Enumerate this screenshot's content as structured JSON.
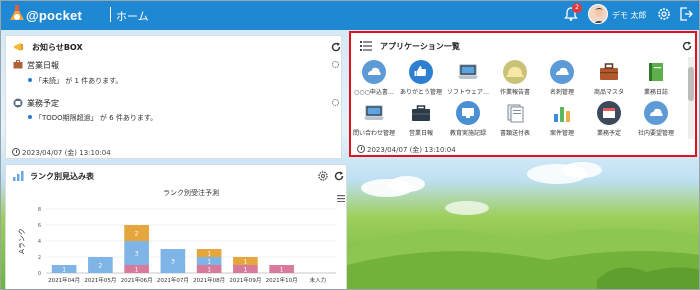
{
  "header": {
    "brand": "@pocket",
    "page": "ホーム",
    "notification_count": "2",
    "user": "デモ 太郎"
  },
  "notices": {
    "title": "お知らせBOX",
    "sections": [
      {
        "heading": "営業日報",
        "item": "「未読」 が 1 件あります。"
      },
      {
        "heading": "業務予定",
        "item": "「TODO期限超過」 が 6 件あります。"
      }
    ],
    "timestamp": "2023/04/07 (金) 13:10:04"
  },
  "apps": {
    "title": "アプリケーション一覧",
    "items": [
      {
        "label": "○○○申込書…",
        "icon": "cloud-icon"
      },
      {
        "label": "ありがとう管理",
        "icon": "thumbs-up-icon"
      },
      {
        "label": "ソフトウェア…",
        "icon": "laptop-icon"
      },
      {
        "label": "作業報告書",
        "icon": "hardhat-icon"
      },
      {
        "label": "名刺管理",
        "icon": "cloud-icon"
      },
      {
        "label": "商品マスタ",
        "icon": "toolbox-icon"
      },
      {
        "label": "業務日誌",
        "icon": "notebook-icon"
      },
      {
        "label": "問い合わせ管理",
        "icon": "laptop-icon"
      },
      {
        "label": "営業日報",
        "icon": "briefcase-icon"
      },
      {
        "label": "教育実施記録",
        "icon": "monitor-icon"
      },
      {
        "label": "書類送付表",
        "icon": "documents-icon"
      },
      {
        "label": "案件管理",
        "icon": "bar-chart-icon"
      },
      {
        "label": "業務予定",
        "icon": "calendar-person-icon"
      },
      {
        "label": "社内要望管理",
        "icon": "cloud-icon"
      }
    ],
    "timestamp": "2023/04/07 (金) 13:10:04"
  },
  "rank_panel": {
    "title": "ランク別見込み表"
  },
  "chart_data": {
    "type": "bar",
    "stacked": true,
    "title": "ランク別受注予測",
    "ylabel": "Aランク",
    "categories": [
      "2021年04月",
      "2021年05月",
      "2021年06月",
      "2021年07月",
      "2021年08月",
      "2021年09月",
      "2021年10月",
      "未入力"
    ],
    "ylim": [
      0,
      8
    ],
    "yticks": [
      0,
      2,
      4,
      6,
      8
    ],
    "series": [
      {
        "values": [
          0,
          0,
          1,
          0,
          1,
          1,
          1,
          0
        ],
        "color": "#d87a9b"
      },
      {
        "values": [
          1,
          2,
          3,
          3,
          1,
          0,
          0,
          0
        ],
        "color": "#7fb5e6"
      },
      {
        "values": [
          0,
          0,
          2,
          0,
          1,
          1,
          0,
          0
        ],
        "color": "#e5a63d"
      }
    ],
    "data_labels": [
      [
        null,
        null,
        "1",
        null,
        "1",
        "1",
        "1",
        null
      ],
      [
        "1",
        "2",
        "3",
        "3",
        "1",
        null,
        null,
        null
      ],
      [
        null,
        null,
        "2",
        null,
        "1",
        "1",
        null,
        null
      ]
    ]
  }
}
